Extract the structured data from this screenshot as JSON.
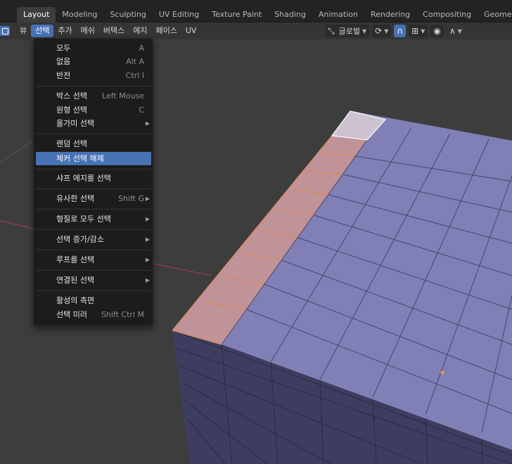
{
  "workspace_tabs": [
    "Layout",
    "Modeling",
    "Sculpting",
    "UV Editing",
    "Texture Paint",
    "Shading",
    "Animation",
    "Rendering",
    "Compositing",
    "Geometry No"
  ],
  "active_tab": "Layout",
  "header_menu": [
    "뷰",
    "선택",
    "추가",
    "메쉬",
    "버텍스",
    "에지",
    "페이스",
    "UV"
  ],
  "open_menu": "선택",
  "header_tools": {
    "orientation_label": "글로벌",
    "orientation_icon": "transform-orientation-icon",
    "pivot_icon": "pivot-point-icon",
    "snap_icon": "magnet-snap-icon",
    "snap_target_icon": "snap-increment-icon",
    "proportional_icon": "proportional-edit-icon",
    "falloff_icon": "falloff-curve-icon"
  },
  "select_menu": {
    "items": [
      {
        "label": "모두",
        "shortcut": "A"
      },
      {
        "label": "없음",
        "shortcut": "Alt A"
      },
      {
        "label": "반전",
        "shortcut": "Ctrl I"
      },
      {
        "label": "박스 선택",
        "shortcut": "Left Mouse"
      },
      {
        "label": "원형 선택",
        "shortcut": "C"
      },
      {
        "label": "올가미 선택",
        "shortcut": ""
      },
      {
        "label": "랜덤 선택",
        "shortcut": ""
      },
      {
        "label": "체커 선택 해제",
        "shortcut": ""
      },
      {
        "label": "샤프 에지를 선택",
        "shortcut": ""
      },
      {
        "label": "유사한 선택",
        "shortcut": "Shift G"
      },
      {
        "label": "형질로 모두 선택",
        "shortcut": ""
      },
      {
        "label": "선택 증가/감소",
        "shortcut": ""
      },
      {
        "label": "루프를 선택",
        "shortcut": ""
      },
      {
        "label": "연결된 선택",
        "shortcut": ""
      },
      {
        "label": "활성의 측면",
        "shortcut": ""
      },
      {
        "label": "선택 미러",
        "shortcut": "Shift Ctrl M"
      }
    ],
    "highlighted": "체커 선택 해제"
  },
  "colors": {
    "accent": "#4772b3",
    "face": "#8181b8",
    "selected_face": "#c49494",
    "active_face": "#d4c9d4",
    "background": "#3d3d3d"
  }
}
